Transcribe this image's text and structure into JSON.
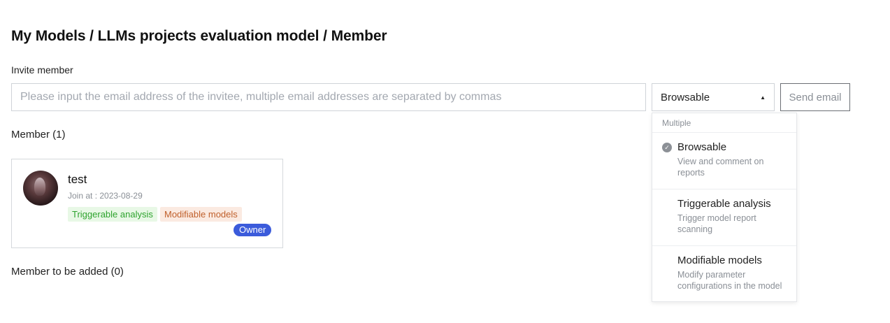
{
  "page": {
    "title": "My Models / LLMs projects evaluation model / Member"
  },
  "invite": {
    "label": "Invite member",
    "email_placeholder": "Please input the email address of the invitee, multiple email addresses are separated by commas",
    "email_value": "",
    "permission_selected": "Browsable",
    "send_label": "Send email"
  },
  "dropdown": {
    "header": "Multiple",
    "options": [
      {
        "title": "Browsable",
        "desc": "View and comment on reports",
        "checked": true
      },
      {
        "title": "Triggerable analysis",
        "desc": "Trigger model report scanning",
        "checked": false
      },
      {
        "title": "Modifiable models",
        "desc": "Modify parameter configurations in the model",
        "checked": false
      }
    ]
  },
  "members": {
    "heading": "Member (1)",
    "list": [
      {
        "name": "test",
        "join": "Join at : 2023-08-29",
        "tags": [
          "Triggerable analysis",
          "Modifiable models"
        ],
        "role": "Owner"
      }
    ]
  },
  "pending": {
    "heading": "Member to be added (0)"
  },
  "colors": {
    "tag_green_text": "#2ea32e",
    "tag_green_bg": "#e8f8e6",
    "tag_orange_text": "#c0602c",
    "tag_orange_bg": "#fbeae1",
    "owner_badge": "#3b5bdb"
  }
}
